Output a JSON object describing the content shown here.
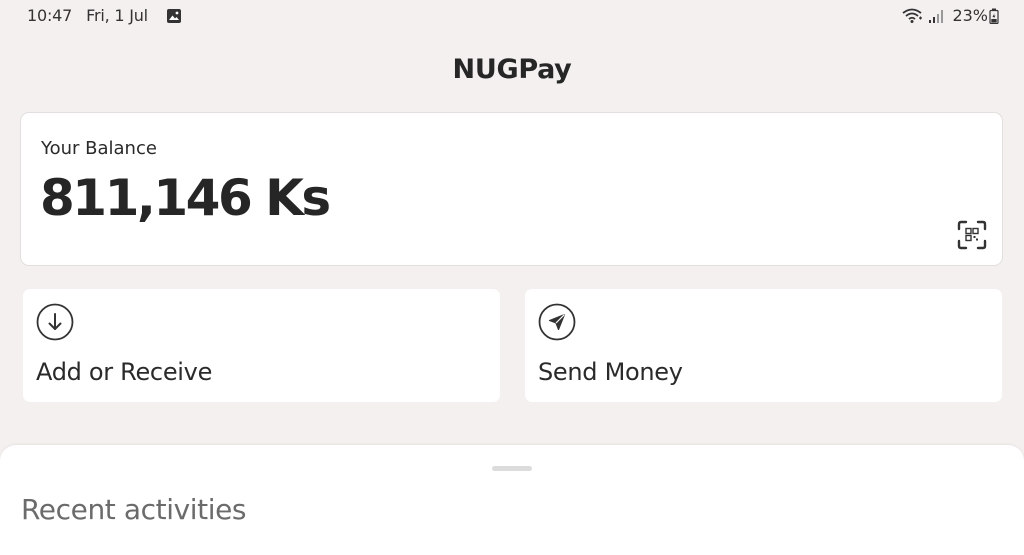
{
  "status_bar": {
    "time": "10:47",
    "date": "Fri, 1 Jul",
    "notification_icon": "gallery-icon",
    "battery_percent": "23%",
    "icons": [
      "wifi-icon",
      "signal-icon",
      "battery-icon"
    ]
  },
  "header": {
    "title": "NUGPay"
  },
  "balance": {
    "label": "Your Balance",
    "amount": "811,146 Ks",
    "action_icon": "qr-scan-icon"
  },
  "actions": [
    {
      "label": "Add or Receive",
      "icon": "arrow-down-circle-icon"
    },
    {
      "label": "Send Money",
      "icon": "send-circle-icon"
    }
  ],
  "recent": {
    "title": "Recent activities"
  },
  "colors": {
    "background": "#f4f0ef",
    "card": "#ffffff",
    "text": "#262626",
    "muted_text": "#6b6b6b"
  }
}
